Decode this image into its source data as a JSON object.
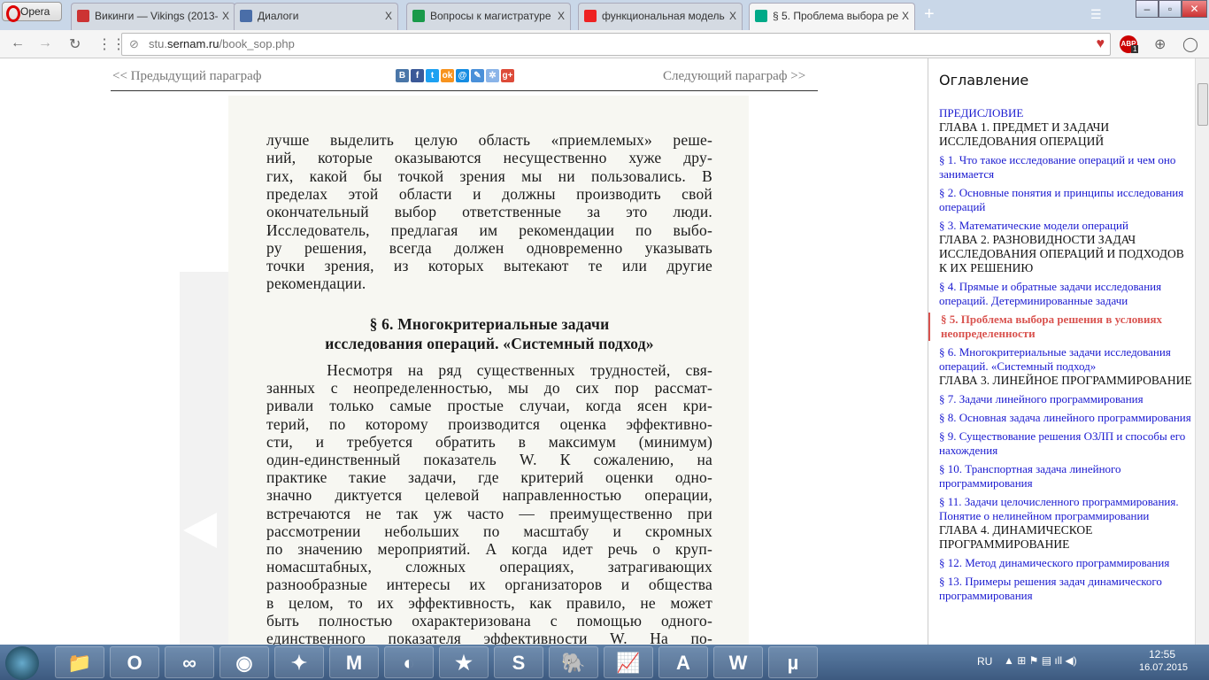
{
  "browser": {
    "opera_label": "Opera",
    "tabs": [
      {
        "title": "Викинги — Vikings (2013-",
        "icon": "tv-icon",
        "color": "#c33"
      },
      {
        "title": "Диалоги",
        "icon": "chat-icon",
        "color": "#4a6ea8"
      },
      {
        "title": "Вопросы к магистратуре",
        "icon": "sheets-icon",
        "color": "#1a9a4a"
      },
      {
        "title": "функциональная модель",
        "icon": "yandex-icon",
        "color": "#e22"
      },
      {
        "title": "§ 5. Проблема выбора ре",
        "icon": "pi-icon",
        "color": "#0a8"
      }
    ],
    "close_glyph": "X",
    "new_tab": "+",
    "url_prefix": "stu.",
    "url_domain": "sernam.ru",
    "url_path": "/book_sop.php",
    "abp_badge": "1"
  },
  "page": {
    "prev": "<< Предыдущий параграф",
    "next": "Следующий параграф >>",
    "share": [
      {
        "l": "B",
        "c": "#4a76a8"
      },
      {
        "l": "f",
        "c": "#3b5998"
      },
      {
        "l": "t",
        "c": "#1da1f2"
      },
      {
        "l": "ok",
        "c": "#f7931e"
      },
      {
        "l": "@",
        "c": "#168de2"
      },
      {
        "l": "✎",
        "c": "#4a90d9"
      },
      {
        "l": "✲",
        "c": "#8ab4e8"
      },
      {
        "l": "g+",
        "c": "#dd4b39"
      }
    ],
    "book_lines": [
      "лучше выделить целую область «приемлемых» реше-",
      "ний, которые оказываются несущественно хуже дру-",
      "гих, какой бы точкой зрения мы ни пользовались. В",
      "пределах этой области и должны производить свой",
      "окончательный выбор ответственные за это люди.",
      "Исследователь, предлагая им рекомендации по выбо-",
      "ру решения, всегда должен одновременно указывать",
      "точки зрения, из которых вытекают те или другие",
      "рекомендации."
    ],
    "heading": [
      "§ 6. Многокритериальные задачи",
      "исследования операций. «Системный подход»"
    ],
    "body_lines": [
      "    Несмотря на ряд существенных трудностей, свя-",
      "занных с неопределенностью, мы до сих пор рассмат-",
      "ривали только самые простые случаи, когда ясен кри-",
      "терий, по которому производится оценка эффективно-",
      "сти, и требуется обратить в максимум (минимум)",
      "один-единственный показатель W. К сожалению, на",
      "практике такие задачи, где критерий оценки одно-",
      "значно диктуется целевой направленностью операции,",
      "встречаются не так уж часто — преимущественно при",
      "рассмотрении небольших по масштабу и скромных",
      "по значению мероприятий. А когда идет речь о круп-",
      "номасштабных, сложных операциях, затрагивающих",
      "разнообразные интересы их организаторов и общества",
      "в целом, то их эффективность, как правило, не может",
      "быть полностью охарактеризована с помощью одного-",
      "единственного показателя эффективности W. На по-"
    ]
  },
  "toc": {
    "title": "Оглавление",
    "items": [
      {
        "t": "ПРЕДИСЛОВИЕ",
        "k": "link"
      },
      {
        "t": "ГЛАВА 1. ПРЕДМЕТ И ЗАДАЧИ ИССЛЕДОВАНИЯ ОПЕРАЦИЙ",
        "k": "ch"
      },
      {
        "t": "§ 1. Что такое исследование операций и чем оно занимается",
        "k": "link"
      },
      {
        "t": "§ 2. Основные понятия и принципы исследования операций",
        "k": "link"
      },
      {
        "t": "§ 3. Математические модели операций",
        "k": "link"
      },
      {
        "t": "ГЛАВА 2. РАЗНОВИДНОСТИ ЗАДАЧ ИССЛЕДОВАНИЯ ОПЕРАЦИЙ И ПОДХОДОВ К ИХ РЕШЕНИЮ",
        "k": "ch"
      },
      {
        "t": "§ 4. Прямые и обратные задачи исследования операций. Детерминированные задачи",
        "k": "link"
      },
      {
        "t": "§ 5. Проблема выбора решения в условиях неопределенности",
        "k": "cur"
      },
      {
        "t": "§ 6. Многокритериальные задачи исследования операций. «Системный подход»",
        "k": "link"
      },
      {
        "t": "ГЛАВА 3. ЛИНЕЙНОЕ ПРОГРАММИРОВАНИЕ",
        "k": "ch"
      },
      {
        "t": "§ 7. Задачи линейного программирования",
        "k": "link"
      },
      {
        "t": "§ 8. Основная задача линейного программирования",
        "k": "link"
      },
      {
        "t": "§ 9. Существование решения ОЗЛП и способы его нахождения",
        "k": "link"
      },
      {
        "t": "§ 10. Транспортная задача линейного программирования",
        "k": "link"
      },
      {
        "t": "§ 11. Задачи целочисленного программирования. Понятие о нелинейном программировании",
        "k": "link"
      },
      {
        "t": "ГЛАВА 4. ДИНАМИЧЕСКОЕ ПРОГРАММИРОВАНИЕ",
        "k": "ch"
      },
      {
        "t": "§ 12. Метод динамического программирования",
        "k": "link"
      },
      {
        "t": "§ 13. Примеры решения задач динамического программирования",
        "k": "link"
      }
    ]
  },
  "taskbar": {
    "apps": [
      {
        "n": "explorer",
        "g": "📁"
      },
      {
        "n": "opera",
        "g": "O"
      },
      {
        "n": "visual-studio",
        "g": "∞"
      },
      {
        "n": "chrome",
        "g": "◉"
      },
      {
        "n": "app",
        "g": "✦"
      },
      {
        "n": "mathcad",
        "g": "M"
      },
      {
        "n": "eclipse",
        "g": "◐"
      },
      {
        "n": "star",
        "g": "★"
      },
      {
        "n": "skype",
        "g": "S"
      },
      {
        "n": "postgres",
        "g": "🐘"
      },
      {
        "n": "chart-app",
        "g": "📈"
      },
      {
        "n": "acrobat",
        "g": "A"
      },
      {
        "n": "word",
        "g": "W"
      },
      {
        "n": "utorrent",
        "g": "µ"
      }
    ],
    "lang": "RU",
    "time": "12:55",
    "date": "16.07.2015"
  }
}
